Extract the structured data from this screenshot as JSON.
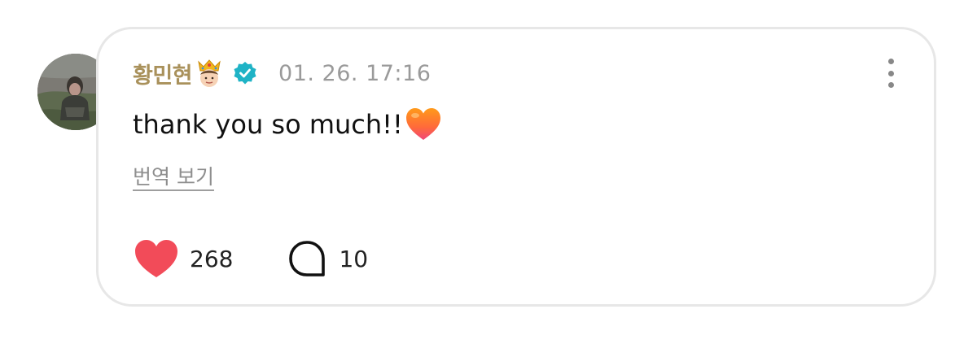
{
  "comment": {
    "author": {
      "name": "황민현",
      "badge_emoji": "crown-prince-icon",
      "verified_icon": "verified-badge-icon",
      "avatar": "avatar-photo"
    },
    "timestamp": "01. 26. 17:16",
    "text": "thank you so much!!",
    "text_emoji": "orange-heart-icon",
    "translate_label": "번역 보기",
    "likes": {
      "count": "268",
      "icon": "heart-icon",
      "color": "#f24b59"
    },
    "replies": {
      "count": "10",
      "icon": "comment-bubble-icon"
    },
    "menu_icon": "more-vertical-icon"
  },
  "colors": {
    "author_name": "#a9915b",
    "verified": "#1fb3c6",
    "timestamp": "#9a9a9a",
    "card_border": "#e7e7e7"
  }
}
